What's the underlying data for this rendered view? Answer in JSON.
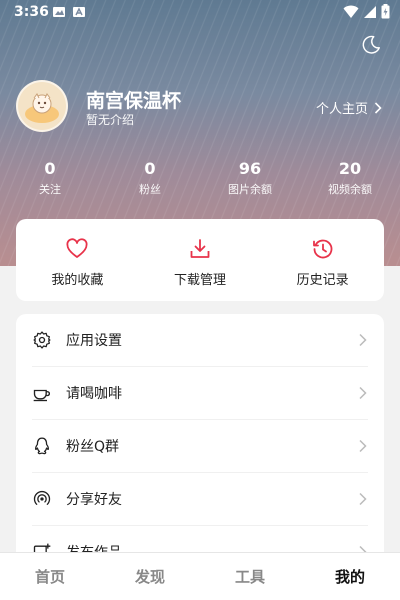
{
  "status": {
    "time": "3:36"
  },
  "profile": {
    "name": "南宫保温杯",
    "bio": "暂无介绍",
    "homepage_label": "个人主页"
  },
  "stats": [
    {
      "value": "0",
      "label": "关注"
    },
    {
      "value": "0",
      "label": "粉丝"
    },
    {
      "value": "96",
      "label": "图片余额"
    },
    {
      "value": "20",
      "label": "视频余额"
    }
  ],
  "quick": [
    {
      "label": "我的收藏",
      "icon": "heart-icon"
    },
    {
      "label": "下载管理",
      "icon": "download-icon"
    },
    {
      "label": "历史记录",
      "icon": "history-icon"
    }
  ],
  "menu": [
    {
      "label": "应用设置",
      "icon": "gear-icon"
    },
    {
      "label": "请喝咖啡",
      "icon": "coffee-icon"
    },
    {
      "label": "粉丝Q群",
      "icon": "qq-icon"
    },
    {
      "label": "分享好友",
      "icon": "share-icon"
    },
    {
      "label": "发布作品",
      "icon": "publish-icon"
    }
  ],
  "tabs": [
    {
      "label": "首页",
      "active": false
    },
    {
      "label": "发现",
      "active": false
    },
    {
      "label": "工具",
      "active": false
    },
    {
      "label": "我的",
      "active": true
    }
  ],
  "colors": {
    "accent": "#e8334a",
    "text": "#222222",
    "muted": "#888888"
  }
}
